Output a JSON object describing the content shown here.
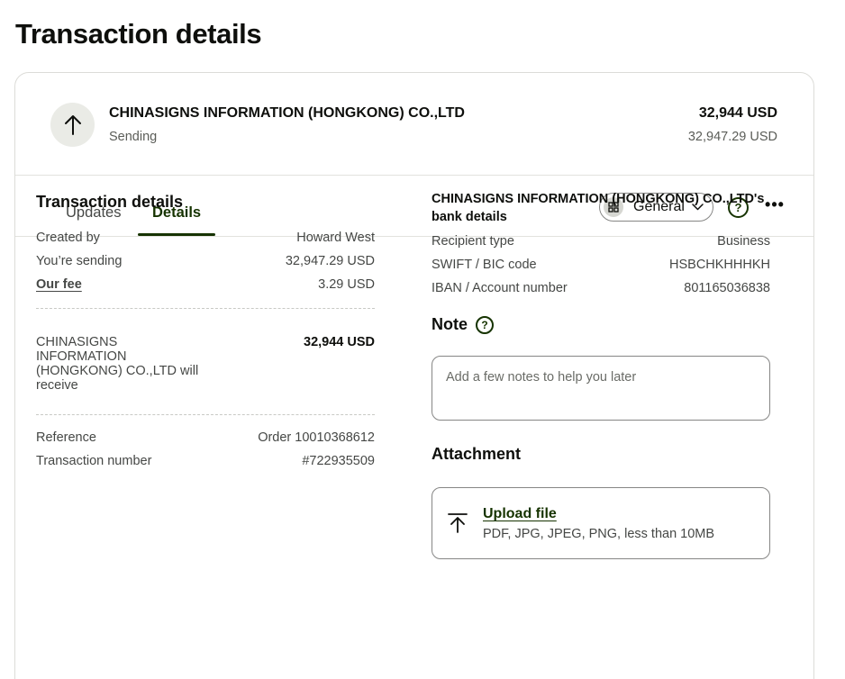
{
  "page_title": "Transaction details",
  "header": {
    "icon": "arrow-up-icon",
    "recipient": "CHINASIGNS INFORMATION (HONGKONG) CO.,LTD",
    "status": "Sending",
    "amount_received": "32,944 USD",
    "amount_sent": "32,947.29 USD"
  },
  "tabs": [
    {
      "label": "Updates",
      "active": false
    },
    {
      "label": "Details",
      "active": true
    }
  ],
  "toolbar": {
    "view_icon": "grid-icon",
    "view_label": "General",
    "help_icon": "question-icon",
    "more_icon": "ellipsis-icon",
    "help_glyph": "?",
    "more_glyph": "•••"
  },
  "details": {
    "title": "Transaction details",
    "rows": [
      {
        "label": "Created by",
        "value": "Howard West"
      },
      {
        "label": "You’re sending",
        "value": "32,947.29 USD"
      },
      {
        "label": "Our fee",
        "value": "3.29 USD"
      }
    ],
    "receive_label": "CHINASIGNS INFORMATION (HONGKONG) CO.,LTD will receive",
    "receive_value": "32,944 USD",
    "reference_rows": [
      {
        "label": "Reference",
        "value": "Order 10010368612"
      },
      {
        "label": "Transaction number",
        "value": "#722935509"
      }
    ]
  },
  "bank": {
    "title": "CHINASIGNS INFORMATION (HONGKONG) CO.,LTD's bank details",
    "rows": [
      {
        "label": "Recipient type",
        "value": "Business"
      },
      {
        "label": "SWIFT / BIC code",
        "value": "HSBCHKHHHKH"
      },
      {
        "label": "IBAN / Account number",
        "value": "801165036838"
      }
    ]
  },
  "note": {
    "title": "Note",
    "placeholder": "Add a few notes to help you later"
  },
  "attachment": {
    "title": "Attachment",
    "upload_label": "Upload file",
    "hint": "PDF, JPG, JPEG, PNG, less than 10MB",
    "icon": "upload-icon"
  },
  "colors": {
    "accent": "#163300",
    "text": "#0e0f0c",
    "muted": "#454745",
    "border": "#868685"
  }
}
